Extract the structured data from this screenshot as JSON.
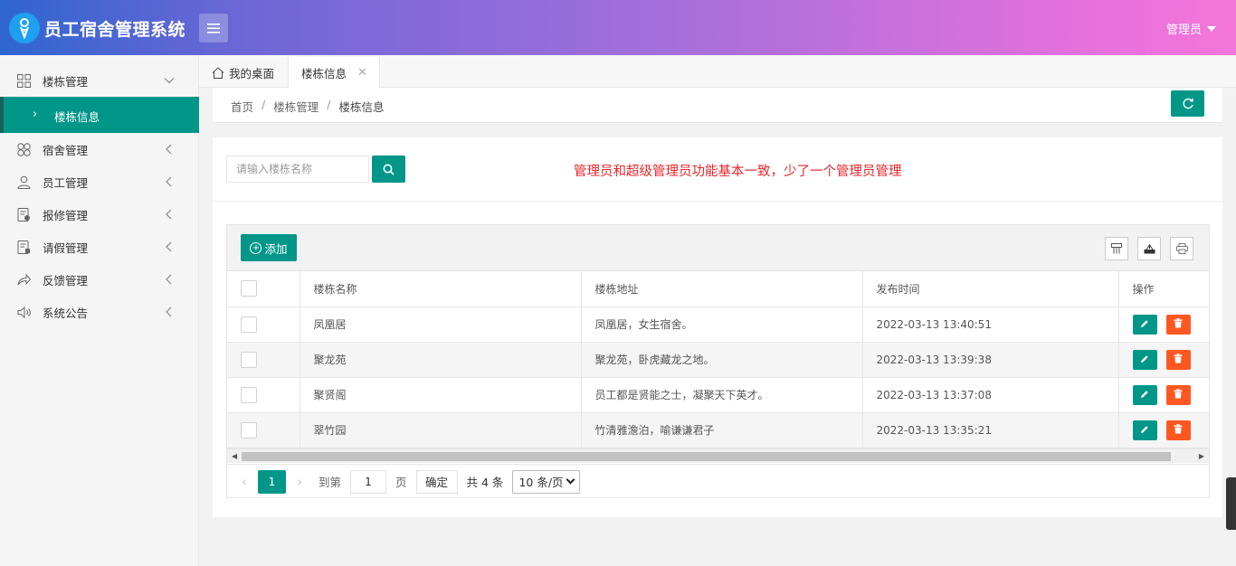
{
  "app": {
    "title": "员工宿舍管理系统"
  },
  "header": {
    "user": "管理员"
  },
  "sidebar": {
    "items": [
      {
        "label": "楼栋管理",
        "icon": "grid-icon",
        "expanded": true
      },
      {
        "label": "宿舍管理",
        "icon": "clover-icon"
      },
      {
        "label": "员工管理",
        "icon": "user-icon"
      },
      {
        "label": "报修管理",
        "icon": "repair-doc-icon"
      },
      {
        "label": "请假管理",
        "icon": "leave-doc-icon"
      },
      {
        "label": "反馈管理",
        "icon": "share-arrow-icon"
      },
      {
        "label": "系统公告",
        "icon": "speaker-icon"
      }
    ],
    "active_sub": "楼栋信息"
  },
  "tabs": {
    "home": "我的桌面",
    "current": "楼栋信息"
  },
  "breadcrumb": [
    "首页",
    "楼栋管理",
    "楼栋信息"
  ],
  "search": {
    "placeholder": "请输入楼栋名称"
  },
  "notice": "管理员和超级管理员功能基本一致，少了一个管理员管理",
  "toolbar": {
    "add_label": "添加"
  },
  "table": {
    "columns": [
      "楼栋名称",
      "楼栋地址",
      "发布时间",
      "操作"
    ],
    "rows": [
      {
        "name": "凤凰居",
        "address": "凤凰居，女生宿舍。",
        "time": "2022-03-13 13:40:51"
      },
      {
        "name": "聚龙苑",
        "address": "聚龙苑，卧虎藏龙之地。",
        "time": "2022-03-13 13:39:38"
      },
      {
        "name": "聚贤阁",
        "address": "员工都是贤能之士，凝聚天下英才。",
        "time": "2022-03-13 13:37:08"
      },
      {
        "name": "翠竹园",
        "address": "竹清雅澹泊，喻谦谦君子",
        "time": "2022-03-13 13:35:21"
      }
    ]
  },
  "pager": {
    "current": "1",
    "goto_label": "到第",
    "page_value": "1",
    "page_label": "页",
    "confirm": "确定",
    "total": "共 4 条",
    "page_size": "10 条/页"
  },
  "colors": {
    "accent": "#009688",
    "danger": "#ff5722",
    "notice": "#e8262b"
  }
}
